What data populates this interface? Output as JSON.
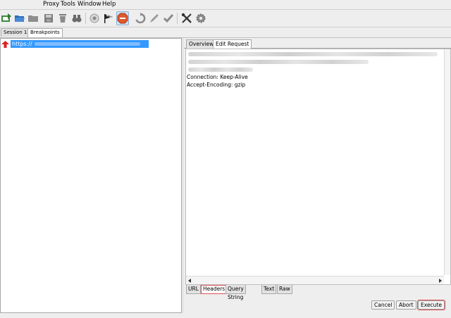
{
  "menu": [
    "Proxy",
    "Tools",
    "Window",
    "Help"
  ],
  "toolbar": {
    "icons": [
      "new-session-icon",
      "open-icon",
      "folder-icon",
      "save-icon",
      "trash-icon",
      "binoculars-icon",
      "record-icon",
      "start-flag-icon",
      "stop-icon",
      "refresh-icon",
      "edit-icon",
      "check-icon",
      "tools-icon",
      "gear-icon"
    ],
    "accent": "#e05a2e"
  },
  "session_tabs": [
    {
      "label": "Session 1 *"
    },
    {
      "label": "Breakpoints"
    }
  ],
  "left": {
    "url_prefix": "https://"
  },
  "right": {
    "tabs": [
      "Overview",
      "Edit Request"
    ],
    "headers": {
      "connection": "Connection: Keep-Alive",
      "encoding": "Accept-Encoding: gzip"
    },
    "bottom_tabs": [
      "URL",
      "Headers",
      "Query String",
      "Text",
      "Raw"
    ],
    "actions": {
      "cancel": "Cancel",
      "abort": "Abort",
      "execute": "Execute"
    },
    "highlight": "#e05050"
  }
}
